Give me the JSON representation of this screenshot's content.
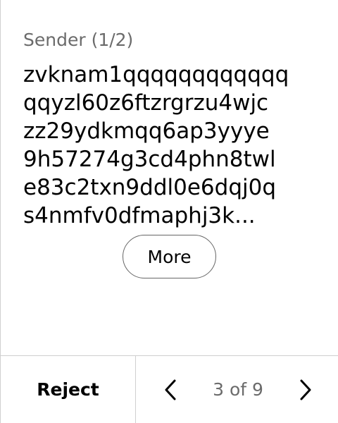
{
  "sender": {
    "label": "Sender (1/2)",
    "address_lines": [
      "zvknam1qqqqqqqqqqqq",
      "qqyzl60z6ftzrgrzu4wjc",
      "zz29ydkmqq6ap3yyye",
      "9h57274g3cd4phn8twl",
      "e83c2txn9ddl0e6dqj0q",
      "s4nmfv0dfmaphj3k..."
    ]
  },
  "more_button": {
    "label": "More"
  },
  "footer": {
    "reject_label": "Reject",
    "page_indicator": "3 of 9",
    "prev_icon": "chevron-left-icon",
    "next_icon": "chevron-right-icon"
  }
}
